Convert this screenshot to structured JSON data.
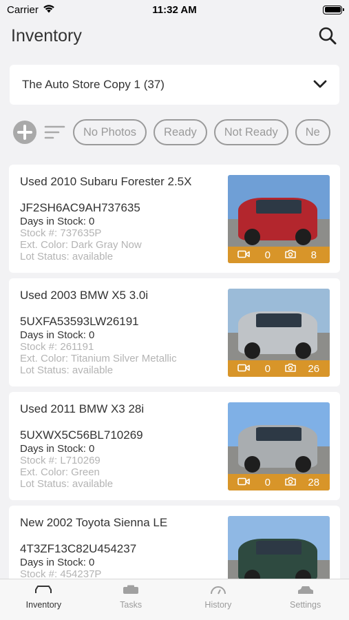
{
  "status_bar": {
    "carrier": "Carrier",
    "time": "11:32 AM"
  },
  "header": {
    "title": "Inventory"
  },
  "store_selector": {
    "value": "The Auto Store Copy 1 (37)"
  },
  "filters": {
    "chips": [
      "No Photos",
      "Ready",
      "Not Ready",
      "Ne"
    ]
  },
  "vehicles": [
    {
      "title": "Used 2010 Subaru Forester 2.5X",
      "vin": "JF2SH6AC9AH737635",
      "days": "Days in Stock: 0",
      "stock": "Stock #: 737635P",
      "color": "Ext. Color: Dark Gray Now",
      "lot": "Lot Status: available",
      "videos": "0",
      "photos": "8",
      "photo_colors": {
        "sky": "#6f9fd6",
        "car": "#b3262d"
      }
    },
    {
      "title": "Used 2003 BMW X5 3.0i",
      "vin": "5UXFA53593LW26191",
      "days": "Days in Stock: 0",
      "stock": "Stock #: 261191",
      "color": "Ext. Color: Titanium Silver Metallic",
      "lot": "Lot Status: available",
      "videos": "0",
      "photos": "26",
      "photo_colors": {
        "sky": "#9bbbd8",
        "car": "#bfc3c7"
      }
    },
    {
      "title": "Used 2011 BMW X3 28i",
      "vin": "5UXWX5C56BL710269",
      "days": "Days in Stock: 0",
      "stock": "Stock #: L710269",
      "color": "Ext. Color: Green",
      "lot": "Lot Status: available",
      "videos": "0",
      "photos": "28",
      "photo_colors": {
        "sky": "#7fb0e6",
        "car": "#a9adb0"
      }
    },
    {
      "title": "New 2002 Toyota Sienna LE",
      "vin": "4T3ZF13C82U454237",
      "days": "Days in Stock: 0",
      "stock": "Stock #: 454237P",
      "color": "",
      "lot": "",
      "videos": "",
      "photos": "",
      "photo_colors": {
        "sky": "#8fb8e4",
        "car": "#2e4a40"
      }
    }
  ],
  "tabs": [
    {
      "label": "Inventory",
      "icon": "car-icon",
      "active": true
    },
    {
      "label": "Tasks",
      "icon": "tasks-icon",
      "active": false
    },
    {
      "label": "History",
      "icon": "history-icon",
      "active": false
    },
    {
      "label": "Settings",
      "icon": "settings-icon",
      "active": false
    }
  ],
  "colors": {
    "accent_bar": "#e0961e",
    "background": "#f2f2f4",
    "chip_border": "#9a9a9a"
  }
}
